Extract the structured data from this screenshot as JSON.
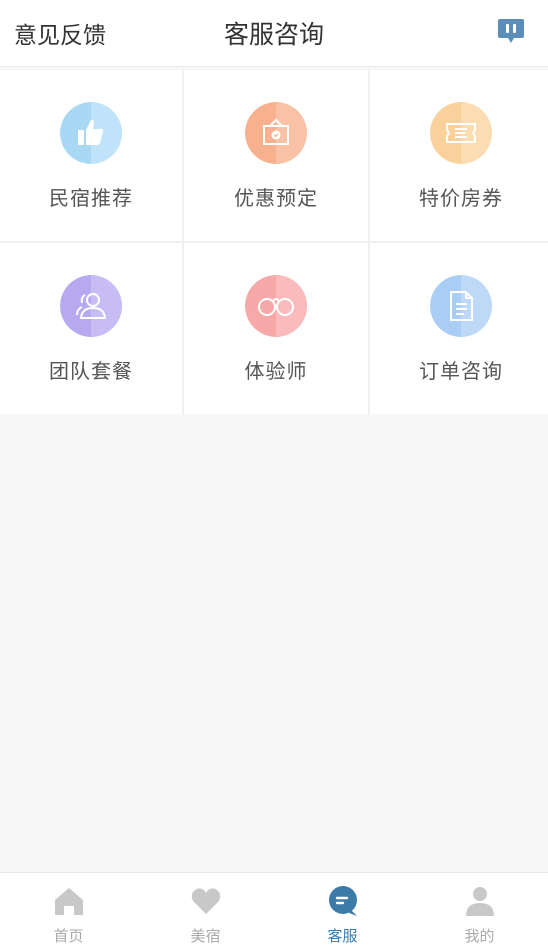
{
  "header": {
    "left_link": "意见反馈",
    "title": "客服咨询",
    "chat_icon": "speech-bubble-icon"
  },
  "services": [
    {
      "label": "民宿推荐",
      "icon": "thumbs-up-icon",
      "color": "#a8d8f4"
    },
    {
      "label": "优惠预定",
      "icon": "coupon-box-icon",
      "color": "#f7b18f"
    },
    {
      "label": "特价房券",
      "icon": "ticket-icon",
      "color": "#fbd19b"
    },
    {
      "label": "团队套餐",
      "icon": "group-icon",
      "color": "#b7a9f0"
    },
    {
      "label": "体验师",
      "icon": "binoculars-icon",
      "color": "#f7a8a8"
    },
    {
      "label": "订单咨询",
      "icon": "document-icon",
      "color": "#a9cdf4"
    }
  ],
  "tabs": [
    {
      "label": "首页",
      "icon": "home-icon"
    },
    {
      "label": "美宿",
      "icon": "heart-icon"
    },
    {
      "label": "客服",
      "icon": "chat-icon",
      "active": true
    },
    {
      "label": "我的",
      "icon": "user-icon"
    }
  ],
  "colors": {
    "accent": "#3c7aa8",
    "inactive_tab": "#aaaaaa"
  }
}
